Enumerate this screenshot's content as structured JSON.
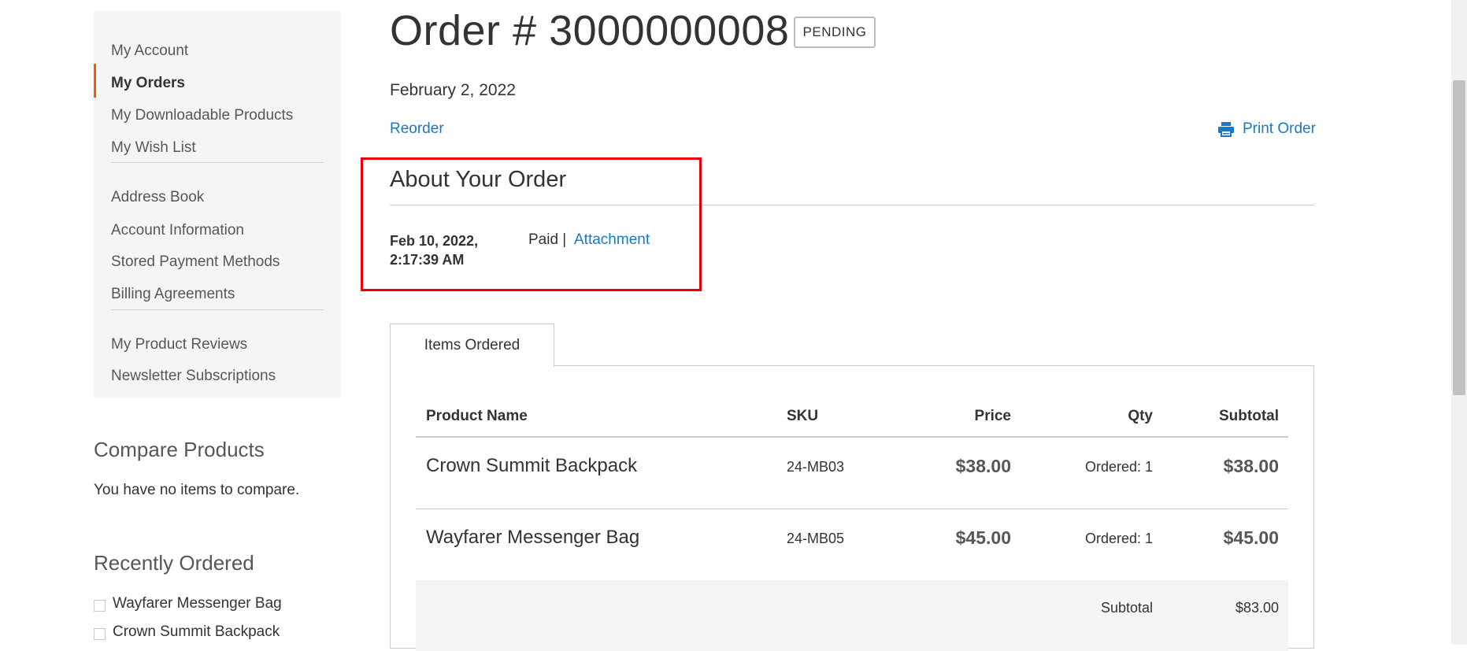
{
  "sidebar": {
    "items": [
      {
        "label": "My Account"
      },
      {
        "label": "My Orders"
      },
      {
        "label": "My Downloadable Products"
      },
      {
        "label": "My Wish List"
      },
      {
        "label": "Address Book"
      },
      {
        "label": "Account Information"
      },
      {
        "label": "Stored Payment Methods"
      },
      {
        "label": "Billing Agreements"
      },
      {
        "label": "My Product Reviews"
      },
      {
        "label": "Newsletter Subscriptions"
      }
    ],
    "active_item": "My Orders",
    "accent_color": "#ff5501"
  },
  "compare": {
    "title": "Compare Products",
    "empty_text": "You have no items to compare."
  },
  "recently_ordered": {
    "title": "Recently Ordered",
    "items": [
      "Wayfarer Messenger Bag",
      "Crown Summit Backpack"
    ]
  },
  "order": {
    "title": "Order # 3000000008",
    "status": "PENDING",
    "date": "February 2, 2022",
    "reorder_label": "Reorder",
    "print_label": "Print Order",
    "print_icon": "printer-icon"
  },
  "about": {
    "title": "About Your Order",
    "comment_date": "Feb 10, 2022,",
    "comment_time": "2:17:39 AM",
    "status_text": "Paid |",
    "attachment_label": "Attachment"
  },
  "items": {
    "tab_label": "Items Ordered",
    "columns": [
      "Product Name",
      "SKU",
      "Price",
      "Qty",
      "Subtotal"
    ],
    "rows": [
      {
        "name": "Crown Summit Backpack",
        "sku": "24-MB03",
        "price": "$38.00",
        "qty": "Ordered: 1",
        "subtotal": "$38.00"
      },
      {
        "name": "Wayfarer Messenger Bag",
        "sku": "24-MB05",
        "price": "$45.00",
        "qty": "Ordered: 1",
        "subtotal": "$45.00"
      }
    ],
    "totals": {
      "label": "Subtotal",
      "value": "$83.00"
    }
  },
  "colors": {
    "link": "#1979c3",
    "highlight_box": "#e8000b"
  }
}
